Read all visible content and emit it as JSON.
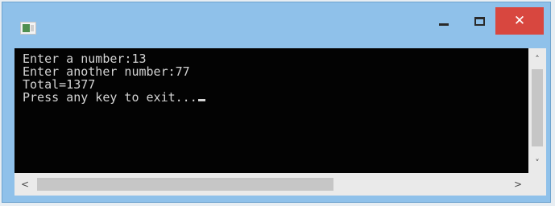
{
  "window": {
    "icon": "console-app-icon",
    "controls": {
      "minimize_icon": "minimize-icon",
      "maximize_icon": "maximize-icon",
      "close_glyph": "✕"
    },
    "colors": {
      "frame": "#8fc1ea",
      "close_button": "#d8473f",
      "console_background": "#030303",
      "console_text": "#d4d4d4"
    }
  },
  "console": {
    "lines": [
      "Enter a number:13",
      "Enter another number:77",
      "Total=1377",
      "Press any key to exit..."
    ]
  },
  "scrollbars": {
    "up_arrow": "˄",
    "down_arrow": "˅",
    "left_arrow": "<",
    "right_arrow": ">"
  }
}
